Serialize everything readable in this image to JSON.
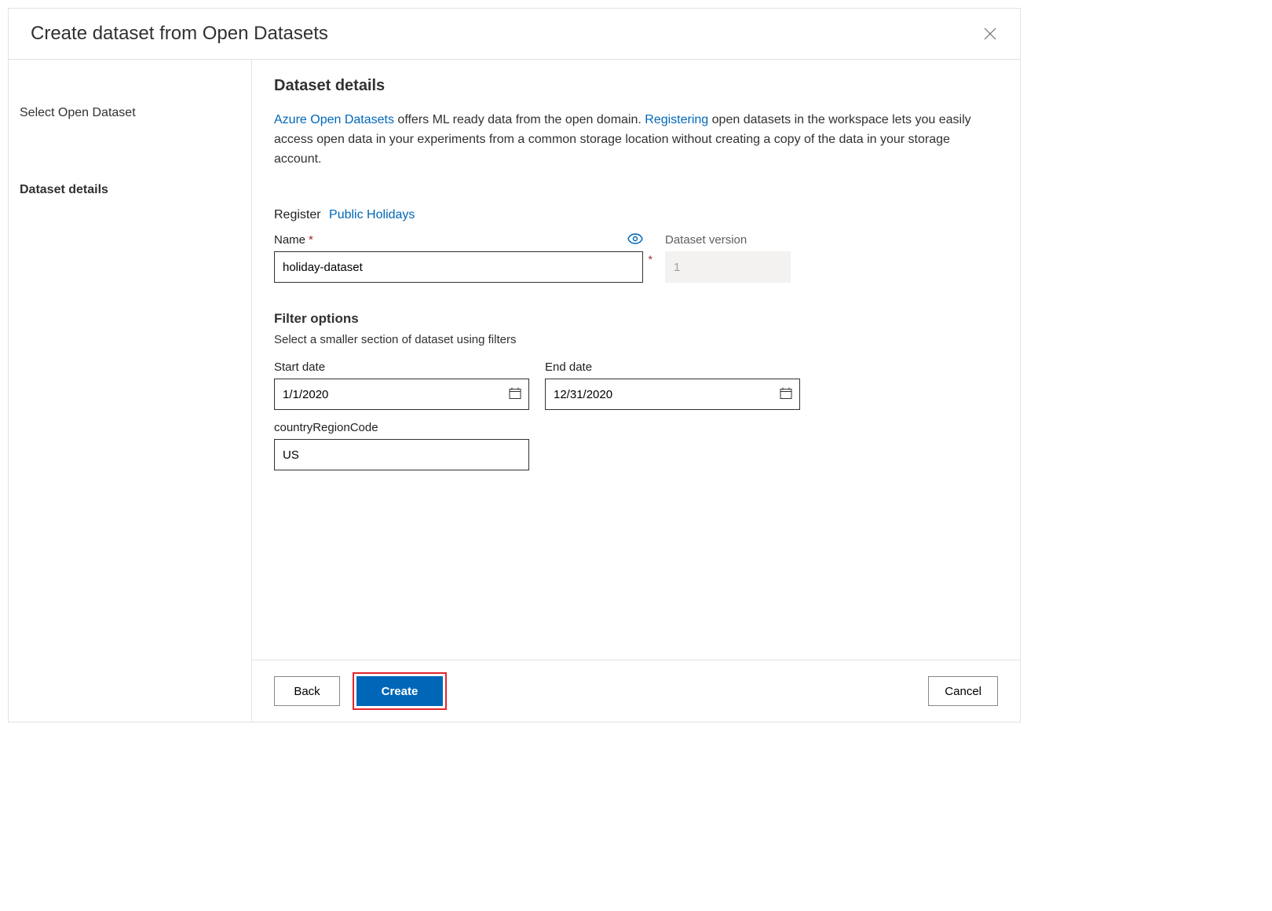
{
  "dialog": {
    "title": "Create dataset from Open Datasets"
  },
  "sidebar": {
    "items": [
      {
        "label": "Select Open Dataset"
      },
      {
        "label": "Dataset details"
      }
    ]
  },
  "main": {
    "heading": "Dataset details",
    "intro": {
      "link1": "Azure Open Datasets",
      "part1": " offers ML ready data from the open domain. ",
      "link2": "Registering",
      "part2": " open datasets in the workspace lets you easily access open data in your experiments from a common storage location without creating a copy of the data in your storage account."
    },
    "register": {
      "label": "Register",
      "link": "Public Holidays"
    },
    "name": {
      "label": "Name",
      "value": "holiday-dataset"
    },
    "version": {
      "label": "Dataset version",
      "value": "1"
    },
    "filter": {
      "title": "Filter options",
      "desc": "Select a smaller section of dataset using filters",
      "start": {
        "label": "Start date",
        "value": "1/1/2020"
      },
      "end": {
        "label": "End date",
        "value": "12/31/2020"
      },
      "country": {
        "label": "countryRegionCode",
        "value": "US"
      }
    }
  },
  "footer": {
    "back": "Back",
    "create": "Create",
    "cancel": "Cancel"
  },
  "glyphs": {
    "required": "*"
  }
}
